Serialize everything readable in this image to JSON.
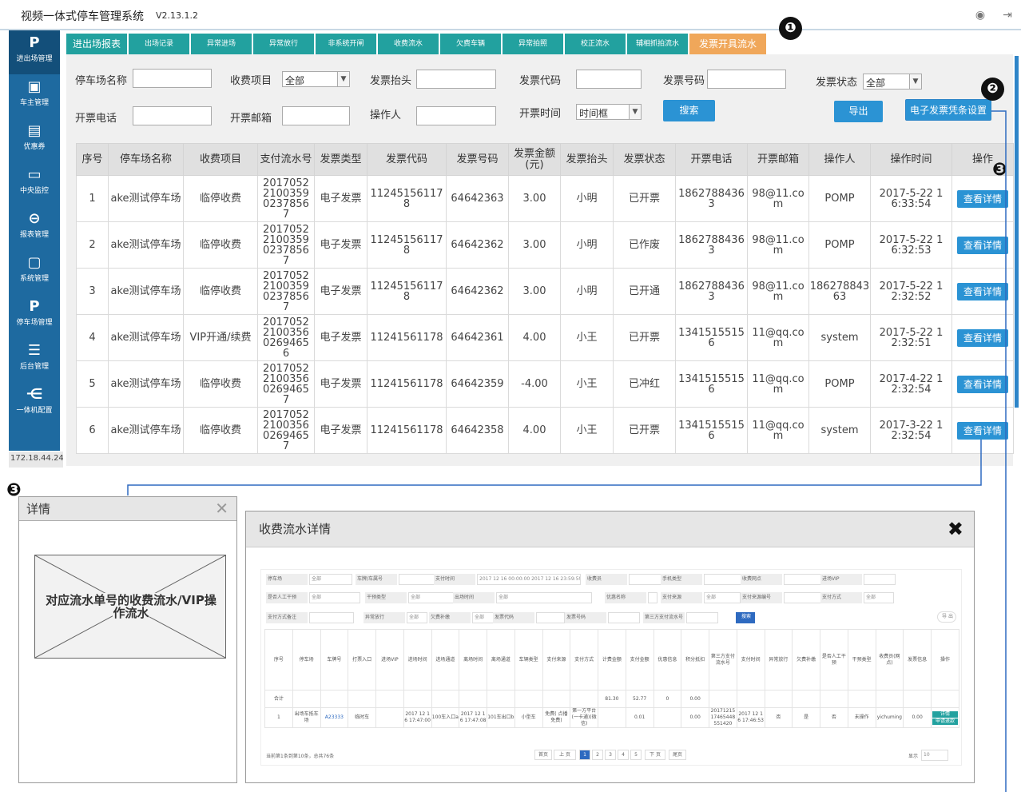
{
  "app": {
    "title": "视频一体式停车管理系统",
    "version": "V2.13.1.2"
  },
  "sidebar": [
    {
      "icon": "P",
      "label": "进出场管理"
    },
    {
      "icon": "▣",
      "label": "车主管理"
    },
    {
      "icon": "▤",
      "label": "优惠券"
    },
    {
      "icon": "▭",
      "label": "中央监控"
    },
    {
      "icon": "⊖",
      "label": "报表管理"
    },
    {
      "icon": "▢",
      "label": "系统管理"
    },
    {
      "icon": "P",
      "label": "停车场管理"
    },
    {
      "icon": "☰",
      "label": "后台管理"
    },
    {
      "icon": "⋲",
      "label": "一体机配置"
    }
  ],
  "ip": "172.18.44.24",
  "tabs": [
    "进出场报表",
    "出场记录",
    "异常进场",
    "异常放行",
    "非系统开闸",
    "收费流水",
    "欠费车辆",
    "异常拍照",
    "校正流水",
    "辅相抓拍流水",
    "发票开具流水"
  ],
  "filters": {
    "parking_name": "停车场名称",
    "fee_item": "收费项目",
    "fee_item_value": "全部",
    "invoice_title": "发票抬头",
    "invoice_code": "发票代码",
    "invoice_no": "发票号码",
    "invoice_status": "发票状态",
    "invoice_status_value": "全部",
    "phone": "开票电话",
    "email": "开票邮箱",
    "operator": "操作人",
    "time": "开票时间",
    "time_value": "时间框"
  },
  "buttons": {
    "search": "搜索",
    "export": "导出",
    "settings": "电子发票凭条设置"
  },
  "table": {
    "headers": [
      "序号",
      "停车场名称",
      "收费项目",
      "支付流水号",
      "发票类型",
      "发票代码",
      "发票号码",
      "发票金额\n(元)",
      "发票抬头",
      "发票状态",
      "开票电话",
      "开票邮箱",
      "操作人",
      "操作时间",
      "操作"
    ],
    "rows": [
      [
        "1",
        "ake测试停车场",
        "临停收费",
        "2017052210035902378567",
        "电子发票",
        "112451561178",
        "64642363",
        "3.00",
        "小明",
        "已开票",
        "18627884363",
        "98@11.com",
        "POMP",
        "2017-5-22 16:33:54"
      ],
      [
        "2",
        "ake测试停车场",
        "临停收费",
        "2017052210035902378567",
        "电子发票",
        "112451561178",
        "64642362",
        "3.00",
        "小明",
        "已作废",
        "18627884363",
        "98@11.com",
        "POMP",
        "2017-5-22 16:32:53"
      ],
      [
        "3",
        "ake测试停车场",
        "临停收费",
        "2017052210035902378567",
        "电子发票",
        "112451561178",
        "64642362",
        "3.00",
        "小明",
        "已开通",
        "18627884363",
        "98@11.com",
        "18627884363",
        "2017-5-22 12:32:52"
      ],
      [
        "4",
        "ake测试停车场",
        "VIP开通/续费",
        "2017052210035602694656",
        "电子发票",
        "11241561178",
        "64642361",
        "4.00",
        "小王",
        "已开票",
        "13415155156",
        "11@qq.com",
        "system",
        "2017-5-22 12:32:51"
      ],
      [
        "5",
        "ake测试停车场",
        "临停收费",
        "2017052210035602694657",
        "电子发票",
        "11241561178",
        "64642359",
        "-4.00",
        "小王",
        "已冲红",
        "13415155156",
        "11@qq.com",
        "POMP",
        "2017-4-22 12:32:54"
      ],
      [
        "6",
        "ake测试停车场",
        "临停收费",
        "2017052210035602694657",
        "电子发票",
        "11241561178",
        "64642358",
        "4.00",
        "小王",
        "已开票",
        "13415155156",
        "11@qq.com",
        "system",
        "2017-3-22 12:32:54"
      ]
    ],
    "view_label": "查看详情"
  },
  "annotations": {
    "a1": "❶",
    "a2": "❷",
    "a3": "❸",
    "b3": "❸"
  },
  "detail_panel": {
    "title": "详情",
    "close": "✕",
    "placeholder": "对应流水单号的收费流水/VIP操作流水"
  },
  "modal": {
    "title": "收费流水详情",
    "close": "✖",
    "filters_row1": [
      [
        "停车场",
        "全部"
      ],
      [
        "车牌/车属号",
        ""
      ],
      [
        "支付时间",
        "2017 12 16 00:00:00   2017 12 16 23:59:59"
      ],
      [
        "收费员",
        ""
      ],
      [
        "手机类型",
        ""
      ],
      [
        "收费网点",
        ""
      ],
      [
        "进场VIP",
        ""
      ]
    ],
    "filters_row2": [
      [
        "是否人工干预",
        "全部"
      ],
      [
        "干预类型",
        "全部"
      ],
      [
        "出场时间",
        "全部"
      ],
      [
        "优惠名称",
        ""
      ],
      [
        "支付来源",
        "全部"
      ],
      [
        "支付来源编号",
        ""
      ],
      [
        "支付方式",
        "全部"
      ]
    ],
    "filters_row3": [
      [
        "支付方式备注",
        ""
      ],
      [
        "异常放行",
        "全部"
      ],
      [
        "欠费补缴",
        "全部"
      ],
      [
        "发票代码",
        ""
      ],
      [
        "发票号码",
        ""
      ],
      [
        "第三方支付流水号",
        ""
      ]
    ],
    "search_label": "搜索",
    "export_label": "导 出",
    "headers": [
      "序号",
      "停车场",
      "车牌号",
      "打票入口",
      "进场VIP",
      "进场时间",
      "进场通道",
      "离场时间",
      "离场通道",
      "车辆类型",
      "支付来源",
      "支付方式",
      "计费金额",
      "支付金额",
      "优惠信息",
      "积分抵扣",
      "第三方支付流水号",
      "支付时间",
      "异常放行",
      "欠费补缴",
      "是否人工干预",
      "干预类型",
      "收费员(网点)",
      "发票信息",
      "操作"
    ],
    "total_label": "合计",
    "total_values": [
      "81.30",
      "52.77",
      "0",
      "0.00"
    ],
    "row": [
      "1",
      "出场车抵车场",
      "A23333",
      "临时车",
      "2017 12 16 17:47:00",
      "100车入口a",
      "2017 12 16 17:47:08",
      "101车出口b",
      "小型车",
      "免费(  点播免费)",
      "第一方平台(一卡通)(微信)",
      "0.01",
      "0.00",
      "2017121517465448551420",
      "2017 12 16 17:46:53",
      "否",
      "是",
      "否",
      "未操作",
      "yichuming",
      "0.00",
      "详情",
      "申请退款"
    ],
    "pager": {
      "info": "当前第1条到第10条，总共76条",
      "first": "首页",
      "prev": "上 页",
      "pages": [
        "1",
        "2",
        "3",
        "4",
        "5"
      ],
      "next": "下 页",
      "last": "尾页",
      "size_label": "显示",
      "size": "10"
    }
  }
}
